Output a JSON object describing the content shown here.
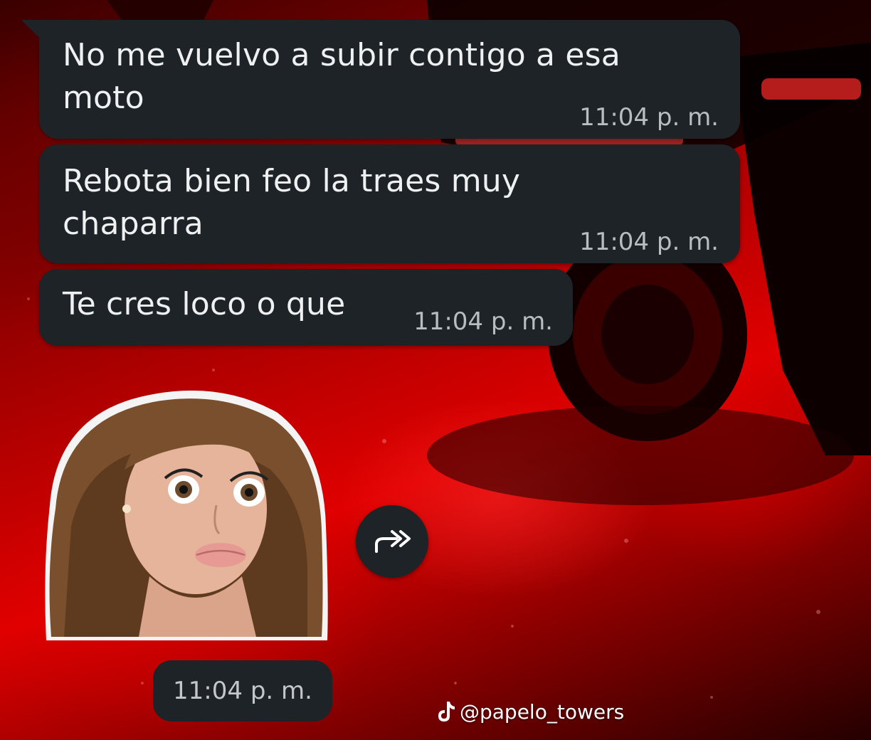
{
  "messages": [
    {
      "text": "No me vuelvo a subir contigo a esa\nmoto",
      "time": "11:04 p. m."
    },
    {
      "text": "Rebota bien feo la traes muy\nchaparra",
      "time": "11:04 p. m."
    },
    {
      "text": "Te cres loco o que",
      "time": "11:04 p. m."
    }
  ],
  "sticker": {
    "icon": "doll-face-sticker",
    "time": "11:04 p. m."
  },
  "forward_button": {
    "icon": "forward-icon"
  },
  "watermark": {
    "icon": "tiktok-icon",
    "handle": "@papelo_towers"
  },
  "colors": {
    "bubble": "#1d2326",
    "text": "#eef0f1",
    "time": "#b8bdc0",
    "background_accent": "#e00000"
  }
}
